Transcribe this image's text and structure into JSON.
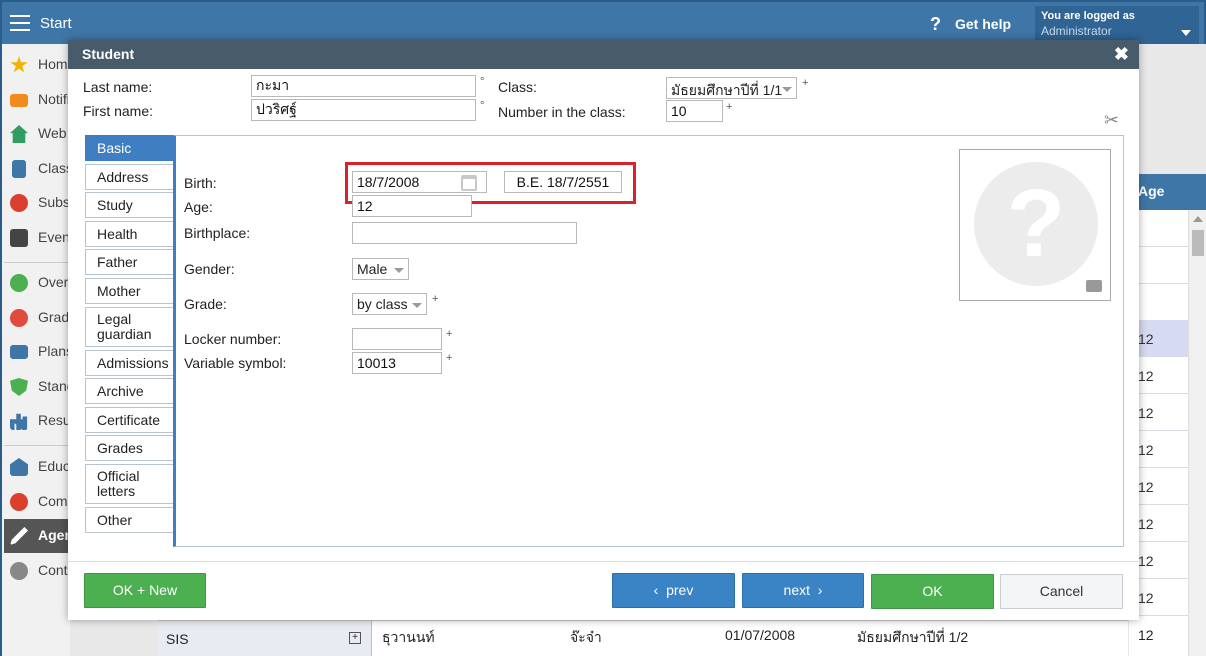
{
  "topbar": {
    "start_label": "Start",
    "help_label": "Get help",
    "logged_label": "You are logged as",
    "user": "Administrator"
  },
  "sidebar": {
    "items": [
      {
        "label": "Home",
        "icon": "star-icon",
        "color": "#f0b400"
      },
      {
        "label": "Notifi",
        "icon": "envelope-icon",
        "color": "#f08c1c"
      },
      {
        "label": "Web",
        "icon": "house-icon",
        "color": "#2f9e5e"
      },
      {
        "label": "Class",
        "icon": "book-icon",
        "color": "#3f76a8"
      },
      {
        "label": "Subst",
        "icon": "person-icon",
        "color": "#d9412e"
      },
      {
        "label": "Event",
        "icon": "calendar-icon",
        "color": "#444444"
      },
      {
        "label": "Overv",
        "icon": "check-circle-icon",
        "color": "#4caf50"
      },
      {
        "label": "Grade",
        "icon": "chart-circle-icon",
        "color": "#e04b3f"
      },
      {
        "label": "Plans",
        "icon": "briefcase-icon",
        "color": "#3f76a8"
      },
      {
        "label": "Stand",
        "icon": "shield-icon",
        "color": "#4caf50"
      },
      {
        "label": "Resu",
        "icon": "bar-chart-icon",
        "color": "#3f76a8"
      },
      {
        "label": "Educ",
        "icon": "building-icon",
        "color": "#3f76a8"
      },
      {
        "label": "Comr",
        "icon": "chat-icon",
        "color": "#d9412e"
      },
      {
        "label": "Agen",
        "icon": "pen-icon",
        "color": "#ffffff"
      },
      {
        "label": "Contr",
        "icon": "gear-icon",
        "color": "#888888"
      }
    ]
  },
  "bg_table": {
    "header": "Age",
    "rows": [
      "",
      "",
      "",
      "12",
      "12",
      "12",
      "12",
      "12",
      "12",
      "12",
      "12",
      "12"
    ]
  },
  "bottom_row": {
    "sis": "SIS",
    "plus": "+",
    "name": "ธุวานนท์",
    "surname": "จ๊ะจ๋า",
    "date": "01/07/2008",
    "class": "มัธยมศึกษาปีที่ 1/2",
    "age": "12"
  },
  "dialog": {
    "title": "Student",
    "close": "✖",
    "last_name_label": "Last name:",
    "last_name_value": "กะมา",
    "first_name_label": "First name:",
    "first_name_value": "ปวริศฐ์",
    "degree_sup": "°",
    "class_label": "Class:",
    "class_value": "มัธยมศึกษาปีที่ 1/1",
    "number_label": "Number in the class:",
    "number_value": "10",
    "required_sup": "+",
    "tabs": [
      "Basic",
      "Address",
      "Study",
      "Health",
      "Father",
      "Mother",
      "Legal guardian",
      "Admissions",
      "Archive",
      "Certificate",
      "Grades",
      "Official letters",
      "Other"
    ],
    "fields": {
      "birth_label": "Birth:",
      "birth_value": "18/7/2008",
      "be_value": "B.E. 18/7/2551",
      "age_label": "Age:",
      "age_value": "12",
      "birthplace_label": "Birthplace:",
      "birthplace_value": "",
      "gender_label": "Gender:",
      "gender_value": "Male",
      "grade_label": "Grade:",
      "grade_value": "by class",
      "locker_label": "Locker number:",
      "locker_value": "",
      "vs_label": "Variable symbol:",
      "vs_value": "10013"
    },
    "photo_placeholder": "?",
    "buttons": {
      "ok_new": "OK + New",
      "prev": "prev",
      "next": "next",
      "ok": "OK",
      "cancel": "Cancel"
    }
  }
}
